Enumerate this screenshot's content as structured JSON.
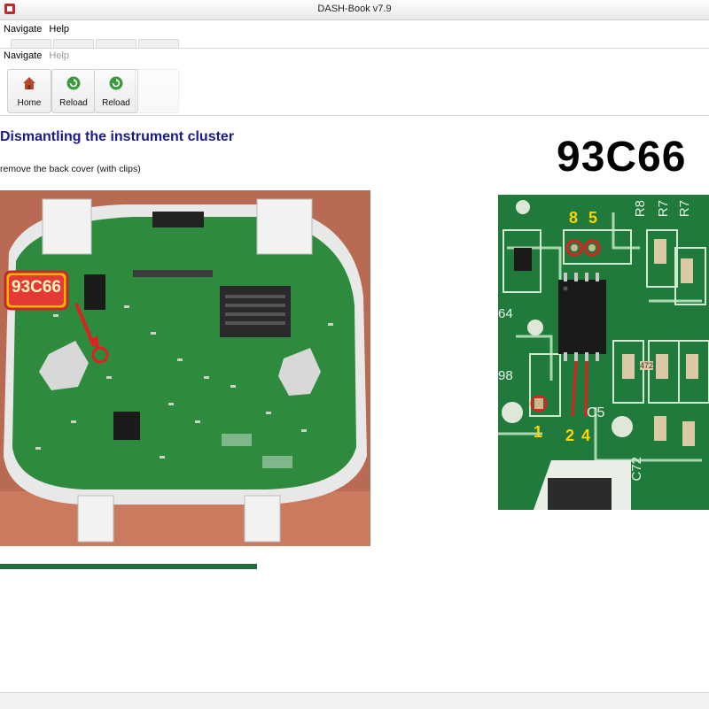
{
  "window": {
    "title": "DASH-Book v7.9"
  },
  "menu_top": {
    "items": [
      "Navigate",
      "Help"
    ]
  },
  "menu_inner": {
    "navigate": "Navigate",
    "help": "Help"
  },
  "toolbar": {
    "buttons": [
      {
        "label": "Home",
        "icon": "home-icon"
      },
      {
        "label": "Reload",
        "icon": "reload-icon"
      },
      {
        "label": "Reload",
        "icon": "reload-icon"
      }
    ]
  },
  "content": {
    "title": "Dismantling the instrument cluster",
    "subtitle": "remove the back cover (with clips)",
    "chip_heading": "93C66",
    "left_photo": {
      "callout": "93C66"
    },
    "right_photo": {
      "silk_labels": [
        "R8",
        "R7",
        "R7",
        "64",
        "98",
        "C72",
        "C5",
        "472"
      ],
      "pin_labels": [
        "8",
        "5",
        "1",
        "2",
        "4"
      ]
    }
  },
  "colors": {
    "title": "#1a1a8c",
    "accent_red": "#e02020",
    "pcb_green": "#1f7a3c",
    "pin_yellow": "#ffd400"
  }
}
